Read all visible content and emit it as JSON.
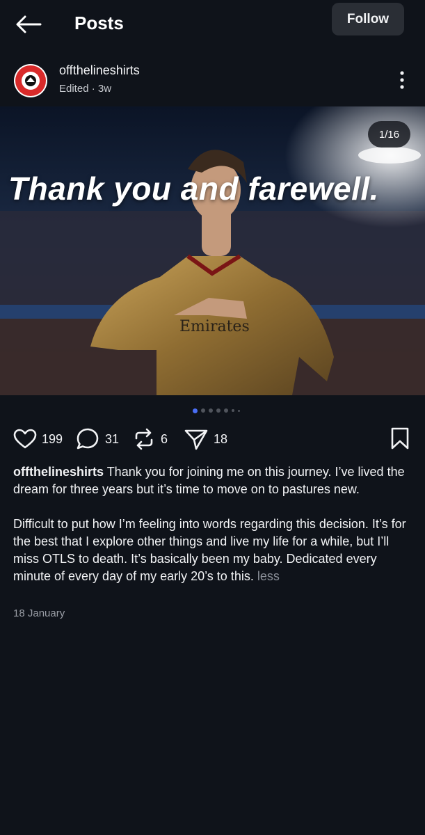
{
  "header": {
    "title": "Posts",
    "follow_label": "Follow"
  },
  "post": {
    "username": "offthelineshirts",
    "meta": "Edited · 3w",
    "image_counter": "1/16",
    "image_text": "Thank you and farewell.",
    "likes": "199",
    "comments": "31",
    "reposts": "6",
    "shares": "18",
    "caption_user": "offthelineshirts",
    "caption_p1": " Thank you for joining me on this journey. I’ve lived the dream for three years but it’s time to move on to pastures new.",
    "caption_p2": "Difficult to put how I’m feeling into words regarding this decision. It’s for the best that I explore other things and live my life for a while, but I’ll miss OTLS to death. It’s basically been my baby. Dedicated every minute of every day of my early 20’s to this. ",
    "less_label": "less",
    "date": "18 January"
  },
  "colors": {
    "background": "#0f131a",
    "accent_dot": "#4a6ef5",
    "follow_bg": "#2a2e35"
  },
  "carousel": {
    "current": 1,
    "total": 16
  }
}
